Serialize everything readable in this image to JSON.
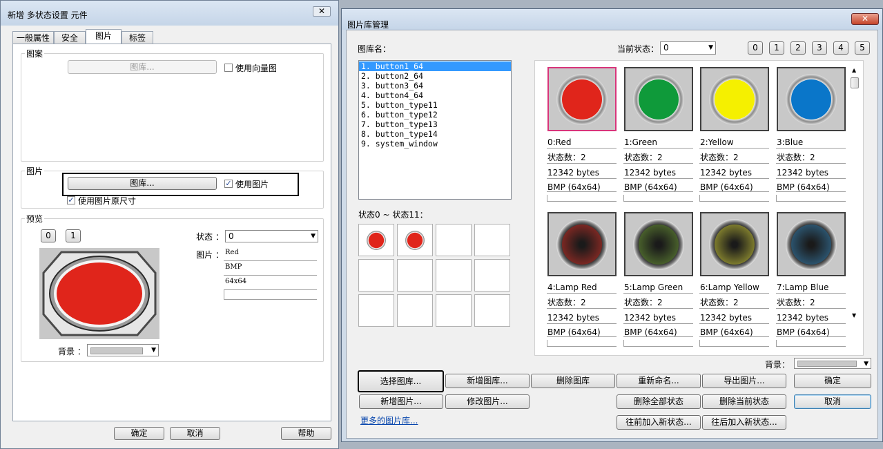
{
  "left_dialog": {
    "title": "新增 多状态设置 元件",
    "tabs": [
      "一般属性",
      "安全",
      "图片",
      "标签"
    ],
    "pattern_group": "图案",
    "pattern_lib_button": "图库...",
    "use_vector_label": "使用向量图",
    "image_group": "图片",
    "image_lib_button": "图库...",
    "use_image_label": "使用图片",
    "use_original_size_label": "使用图片原尺寸",
    "preview_group": "预览",
    "state_buttons": [
      "0",
      "1"
    ],
    "state_label": "状态 ：",
    "state_value": "0",
    "image_label": "图片 ：",
    "image_fields": [
      "Red",
      "BMP",
      "64x64",
      ""
    ],
    "bg_label": "背景 ：",
    "ok": "确定",
    "cancel": "取消",
    "help": "帮助"
  },
  "right_dialog": {
    "title": "图片库管理",
    "lib_name_label": "图库名：",
    "current_state_label": "当前状态：",
    "current_state_value": "0",
    "state_buttons": [
      "0",
      "1",
      "2",
      "3",
      "4",
      "5"
    ],
    "libraries": [
      "1. button1_64",
      "2. button2_64",
      "3. button3_64",
      "4. button4_64",
      "5. button_type11",
      "6. button_type12",
      "7. button_type13",
      "8. button_type14",
      "9. system_window"
    ],
    "states_label": "状态0 ~ 状态11：",
    "images": [
      {
        "name": "0:Red",
        "states": "状态数：2",
        "size": "12342 bytes",
        "format": "BMP (64x64)",
        "color": "#e0251b"
      },
      {
        "name": "1:Green",
        "states": "状态数：2",
        "size": "12342 bytes",
        "format": "BMP (64x64)",
        "color": "#0f9a3a"
      },
      {
        "name": "2:Yellow",
        "states": "状态数：2",
        "size": "12342 bytes",
        "format": "BMP (64x64)",
        "color": "#f5f000"
      },
      {
        "name": "3:Blue",
        "states": "状态数：2",
        "size": "12342 bytes",
        "format": "BMP (64x64)",
        "color": "#0a76c9"
      },
      {
        "name": "4:Lamp Red",
        "states": "状态数：2",
        "size": "12342 bytes",
        "format": "BMP (64x64)",
        "color": "#8a2a24"
      },
      {
        "name": "5:Lamp Green",
        "states": "状态数：2",
        "size": "12342 bytes",
        "format": "BMP (64x64)",
        "color": "#4f6a2e"
      },
      {
        "name": "6:Lamp Yellow",
        "states": "状态数：2",
        "size": "12342 bytes",
        "format": "BMP (64x64)",
        "color": "#8c8a30"
      },
      {
        "name": "7:Lamp Blue",
        "states": "状态数：2",
        "size": "12342 bytes",
        "format": "BMP (64x64)",
        "color": "#2e5c7a"
      }
    ],
    "bg_label": "背景：",
    "buttons": {
      "select_lib": "选择图库...",
      "new_lib": "新增图库...",
      "delete_lib": "删除图库",
      "rename": "重新命名...",
      "export": "导出图片...",
      "ok": "确定",
      "new_image": "新增图片...",
      "edit_image": "修改图片...",
      "delete_all_states": "删除全部状态",
      "delete_current_state": "删除当前状态",
      "cancel": "取消",
      "insert_before": "往前加入新状态...",
      "insert_after": "往后加入新状态..."
    },
    "more_libs_link": "更多的图片库..."
  },
  "colors": {
    "accent_select": "#3399ff",
    "selected_thumb": "#d8347a",
    "red_button": "#e0251b"
  }
}
